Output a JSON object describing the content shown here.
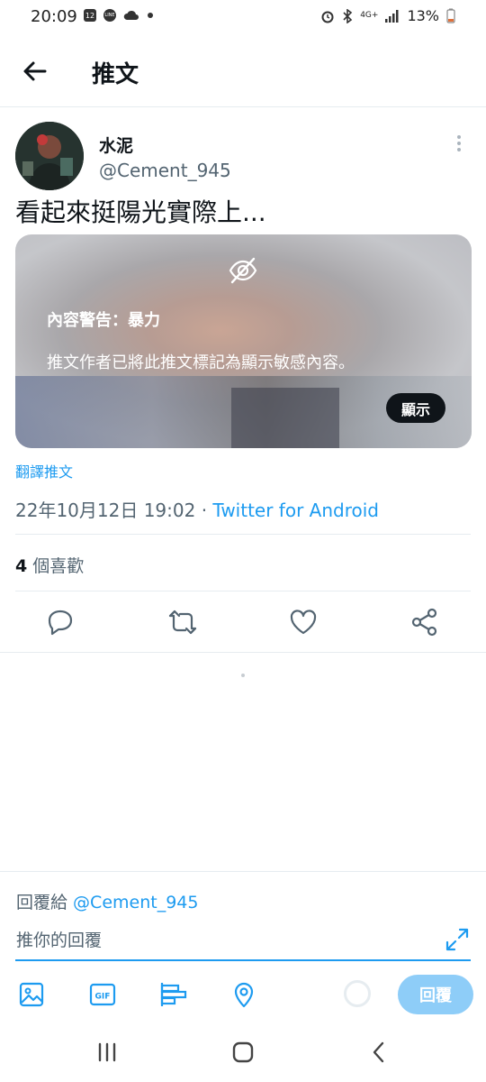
{
  "status_bar": {
    "time": "20:09",
    "calendar_badge": "12",
    "line_badge": "LINE",
    "network": "4G+",
    "battery": "13%"
  },
  "header": {
    "title": "推文"
  },
  "tweet": {
    "author_name": "水泥",
    "author_handle": "@Cement_945",
    "text": "看起來挺陽光實際上...",
    "media": {
      "warning_title": "內容警告：暴力",
      "warning_text": "推文作者已將此推文標記為顯示敏感內容。",
      "show_label": "顯示"
    },
    "translate_label": "翻譯推文",
    "timestamp": "22年10月12日 19:02 · ",
    "source": "Twitter for Android",
    "likes_count": "4",
    "likes_label": " 個喜歡"
  },
  "composer": {
    "replying_prefix": "回覆給 ",
    "replying_to": "@Cement_945",
    "placeholder": "推你的回覆",
    "reply_label": "回覆"
  },
  "colors": {
    "accent": "#1d9bf0",
    "text": "#0f1419",
    "muted": "#536471"
  }
}
